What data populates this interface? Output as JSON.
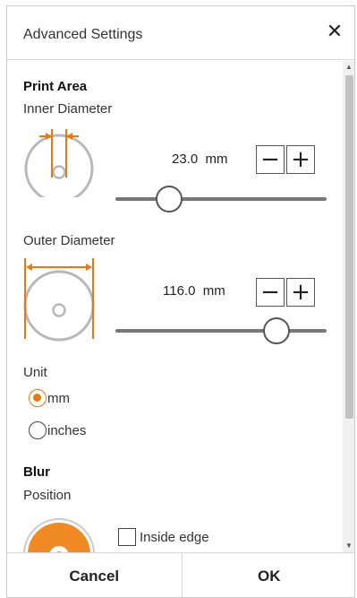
{
  "dialog": {
    "title": "Advanced Settings",
    "close_icon": "close-icon"
  },
  "print_area": {
    "heading": "Print Area",
    "inner": {
      "label": "Inner Diameter",
      "value": "23.0",
      "unit": "mm",
      "slider_fraction": 0.22
    },
    "outer": {
      "label": "Outer Diameter",
      "value": "116.0",
      "unit": "mm",
      "slider_fraction": 0.8
    },
    "unit": {
      "label": "Unit",
      "options": [
        {
          "label": "mm",
          "selected": true
        },
        {
          "label": "inches",
          "selected": false
        }
      ]
    }
  },
  "blur": {
    "heading": "Blur",
    "position_label": "Position",
    "inside_edge_label": "Inside edge",
    "inside_edge_checked": false
  },
  "stepper": {
    "minus_icon": "minus-icon",
    "plus_icon": "plus-icon"
  },
  "footer": {
    "cancel_label": "Cancel",
    "ok_label": "OK"
  },
  "colors": {
    "accent": "#e8780f",
    "disc_gray": "#b8b8b8"
  }
}
